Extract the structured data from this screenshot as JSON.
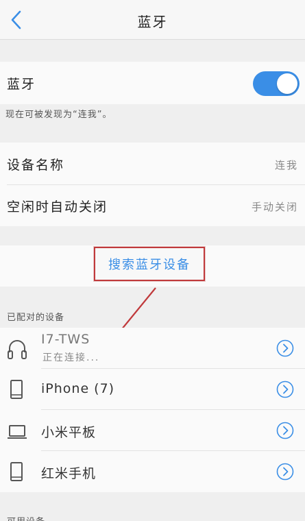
{
  "nav": {
    "title": "蓝牙"
  },
  "bluetooth": {
    "label": "蓝牙",
    "enabled": true,
    "discoverable_note": "现在可被发现为“连我”。"
  },
  "settings": {
    "device_name_label": "设备名称",
    "device_name_value": "连我",
    "idle_off_label": "空闲时自动关闭",
    "idle_off_value": "手动关闭"
  },
  "search": {
    "label": "搜索蓝牙设备"
  },
  "paired": {
    "heading": "已配对的设备",
    "devices": [
      {
        "name": "I7-TWS",
        "status": "正在连接...",
        "icon": "headphones-icon"
      },
      {
        "name": "iPhone (7)",
        "icon": "phone-icon"
      },
      {
        "name": "小米平板",
        "icon": "laptop-icon"
      },
      {
        "name": "红米手机",
        "icon": "phone-icon"
      }
    ]
  },
  "available": {
    "heading": "可用设备"
  },
  "colors": {
    "accent": "#3a8ee6",
    "annotation_red": "#c0393b"
  }
}
